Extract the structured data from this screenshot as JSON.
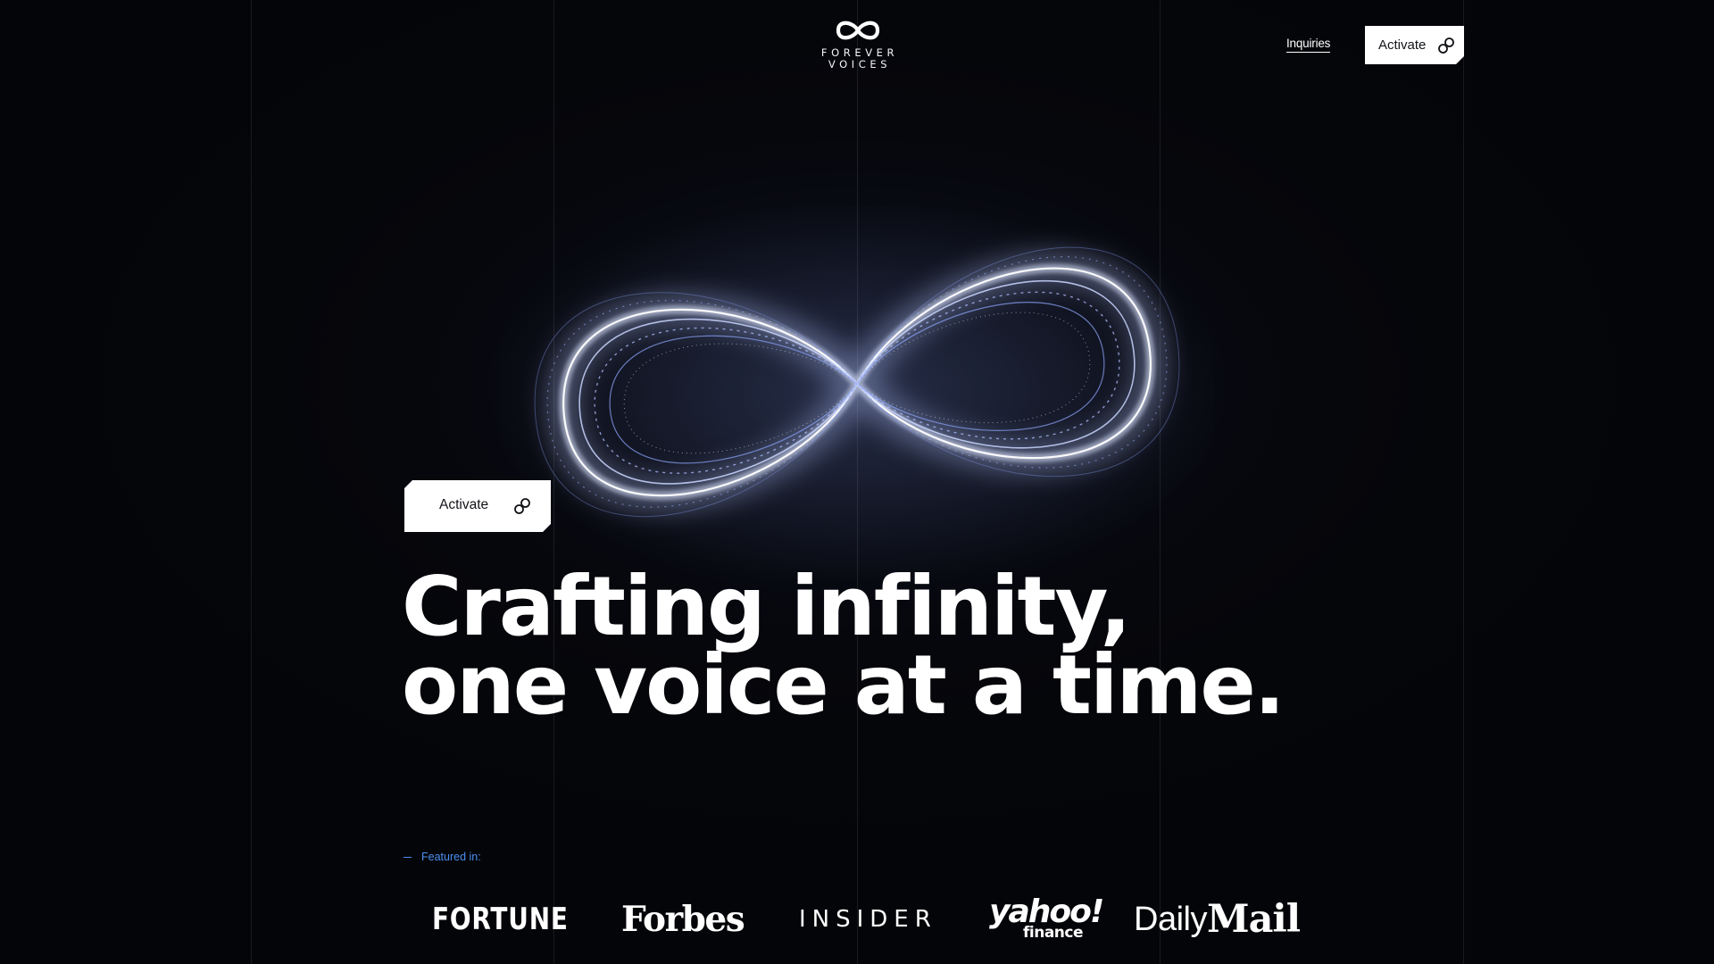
{
  "brand": {
    "logo_line1": "FOREVER",
    "logo_line2": "VOICES",
    "logo_icon": "infinity-icon"
  },
  "nav": {
    "inquiries_label": "Inquiries",
    "activate_label": "Activate",
    "activate_icon": "link-icon"
  },
  "hero": {
    "cta_label": "Activate",
    "cta_icon": "link-icon",
    "headline_line1": "Crafting infinity,",
    "headline_line2": "one voice at a time."
  },
  "featured": {
    "label": "Featured in:",
    "logos": {
      "fortune": "FORTUNE",
      "forbes": "Forbes",
      "insider": "INSIDER",
      "yahoo_main": "yahoo!",
      "yahoo_sub": "finance",
      "dailymail_a": "Daily",
      "dailymail_b": "Mail"
    }
  },
  "colors": {
    "background": "#05060a",
    "accent_blue": "#4a8ff0",
    "button_bg": "#ffffff",
    "button_text": "#111318"
  }
}
